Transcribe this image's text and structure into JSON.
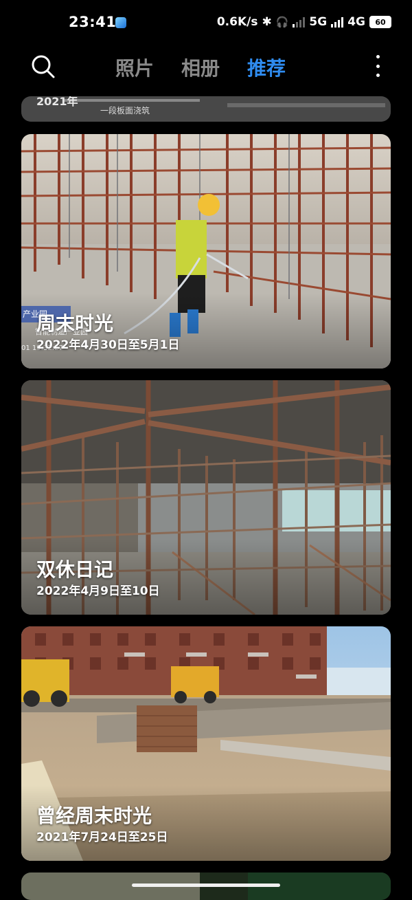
{
  "status_bar": {
    "time": "23:41",
    "net_speed": "0.6K/s",
    "network_1": "5G",
    "network_2": "4G",
    "battery": "60"
  },
  "header": {
    "tabs": [
      {
        "label": "照片",
        "active": false
      },
      {
        "label": "相册",
        "active": false
      },
      {
        "label": "推荐",
        "active": true
      }
    ],
    "accent_color": "#2f8cf0"
  },
  "cards": {
    "partial_top": {
      "year": "2021年",
      "caption": "一段板面浇筑"
    },
    "memory_1": {
      "title": "周末时光",
      "date": "2022年4月30日至5月1日",
      "photo_overlay_badge": "产业园",
      "photo_overlay_sub": "智能制造产业园",
      "photo_overlay_time": "01 19:32:27"
    },
    "memory_2": {
      "title": "双休日记",
      "date": "2022年4月9日至10日"
    },
    "memory_3": {
      "title": "曾经周末时光",
      "date": "2021年7月24日至25日"
    }
  }
}
